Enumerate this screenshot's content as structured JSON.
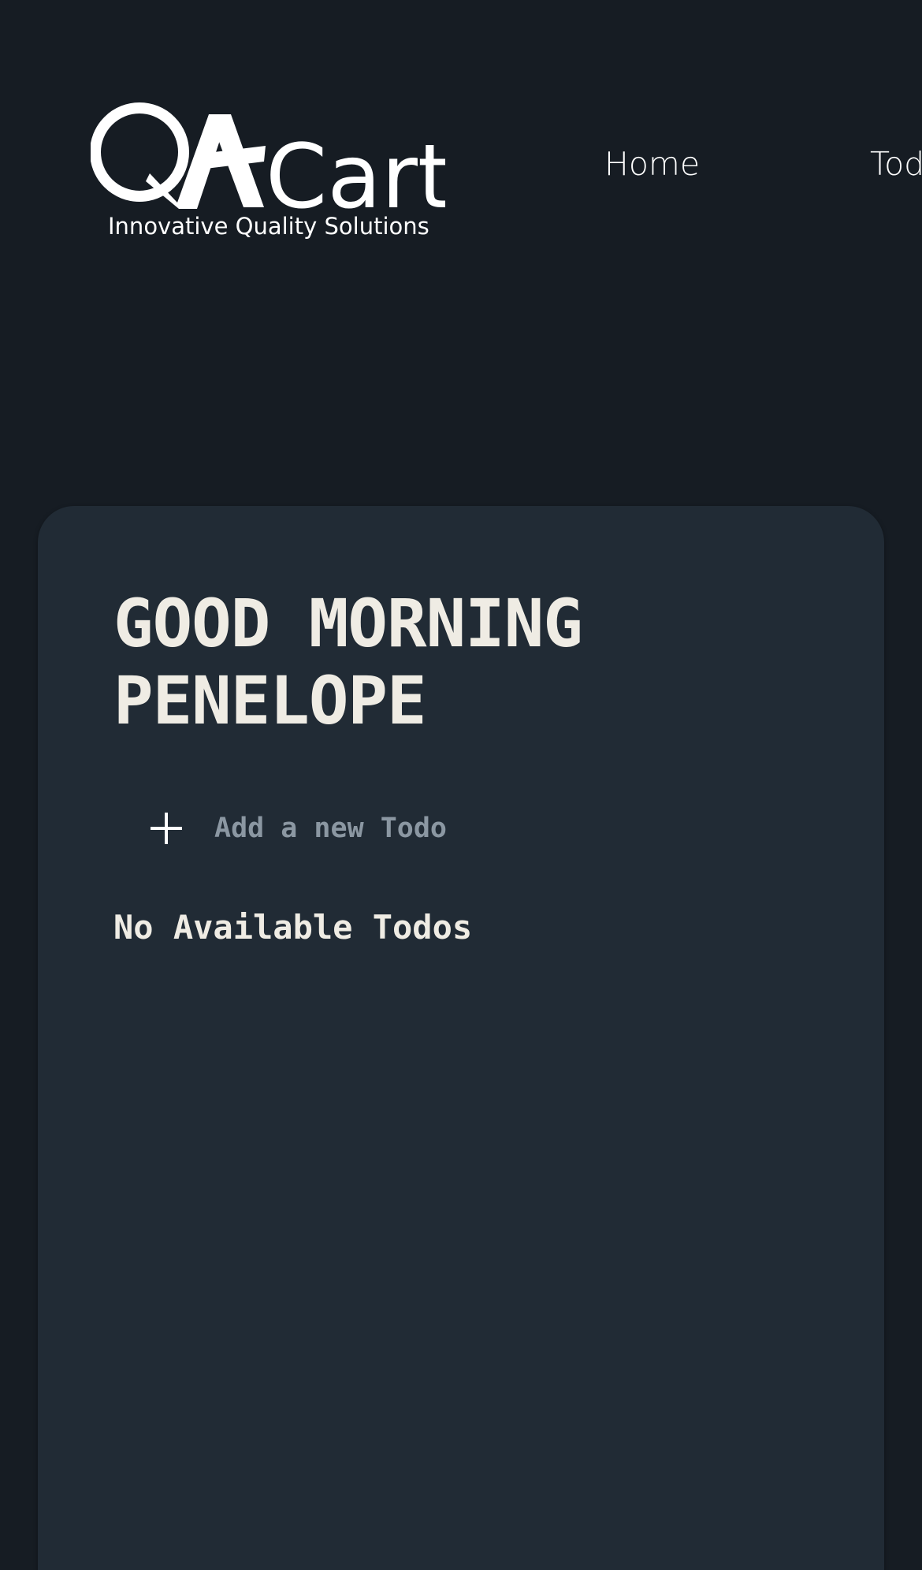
{
  "brand": {
    "name_mark": "QA",
    "name_suffix": "Cart",
    "tagline": "Innovative Quality Solutions"
  },
  "nav": {
    "items": [
      {
        "label": "Home"
      },
      {
        "label": "Todos"
      }
    ]
  },
  "main": {
    "greeting": "GOOD MORNING PENELOPE",
    "new_todo": {
      "placeholder": "Add a new Todo",
      "value": "",
      "icon": "plus-icon"
    },
    "empty_message": "No Available Todos"
  },
  "colors": {
    "page_background": "#161c23",
    "card_background": "#212b35",
    "text_primary": "#efece4",
    "placeholder": "#8b97a2"
  }
}
